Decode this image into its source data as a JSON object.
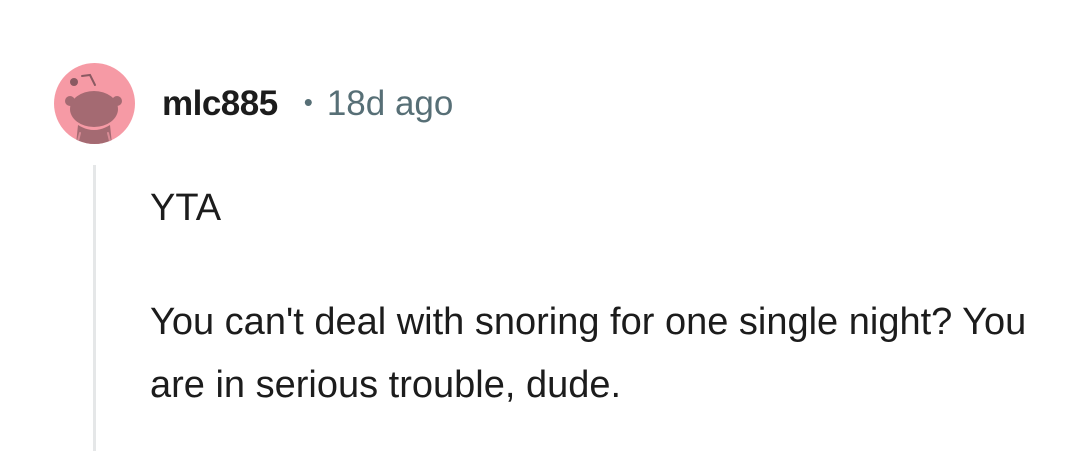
{
  "comment": {
    "avatar_icon": "reddit-snoo-avatar-icon",
    "avatar_color": "#f69aa5",
    "username": "mlc885",
    "separator": "•",
    "timestamp": "18d ago",
    "paragraphs": [
      "YTA",
      "You can't deal with snoring for one single night? You are in serious trouble, dude."
    ]
  }
}
